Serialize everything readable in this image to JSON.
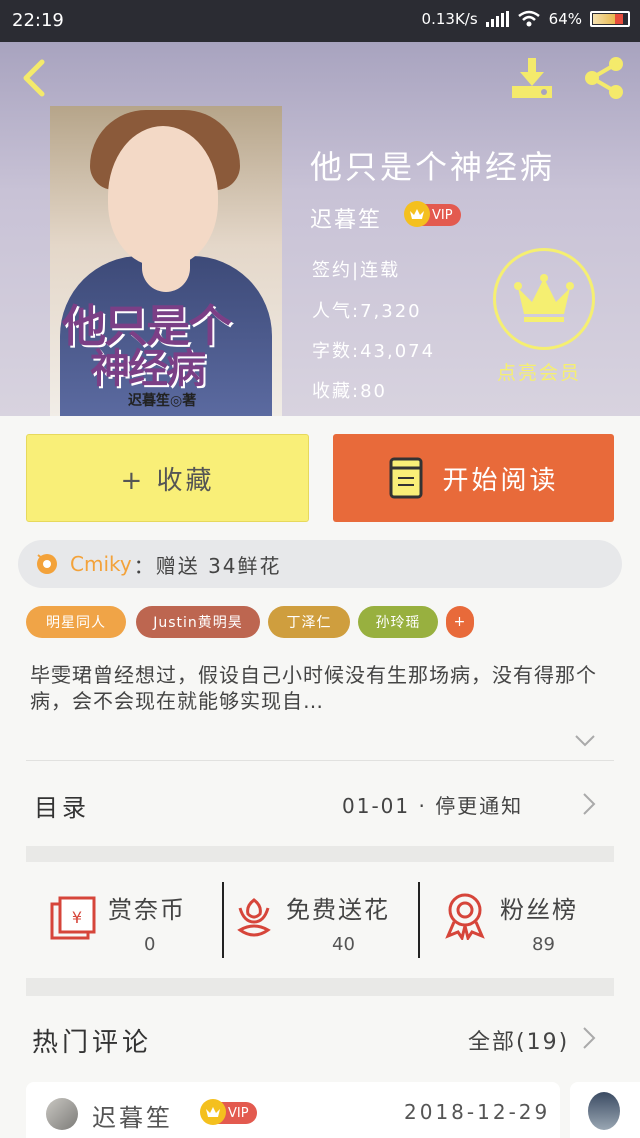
{
  "status_bar": {
    "time": "22:19",
    "speed": "0.13K/s",
    "battery": "64%"
  },
  "book": {
    "title": "他只是个神经病",
    "author": "迟暮笙",
    "author_badge": "VIP",
    "status": "签约|连载",
    "popularity": "人气:7,320",
    "word_count": "字数:43,074",
    "favorites": "收藏:80",
    "cover_title_line1": "他只是个",
    "cover_title_line2": "神经病",
    "cover_author": "迟暮笙◎著"
  },
  "member": {
    "label": "点亮会员"
  },
  "actions": {
    "collect_label": "+ 收藏",
    "read_label": "开始阅读"
  },
  "gift": {
    "user": "Cmiky",
    "text": "：赠送 34鲜花"
  },
  "tags": [
    "明星同人",
    "Justin黄明昊",
    "丁泽仁",
    "孙玲瑶",
    "+"
  ],
  "description": "毕雯珺曾经想过，假设自己小时候没有生那场病，没有得那个病，会不会现在就能够实现自…",
  "catalog": {
    "label": "目录",
    "latest": "01-01 · 停更通知"
  },
  "stats": [
    {
      "label": "赏奈币",
      "value": "0"
    },
    {
      "label": "免费送花",
      "value": "40"
    },
    {
      "label": "粉丝榜",
      "value": "89"
    }
  ],
  "comments": {
    "header": "热门评论",
    "all_label": "全部(19)",
    "first": {
      "author": "迟暮笙",
      "badge": "VIP",
      "date": "2018-12-29"
    }
  },
  "colors": {
    "collect_bg": "#f9ef78",
    "read_bg": "#e86a3a",
    "vip_bg": "#e35a4f",
    "member_accent": "#f5ef71",
    "gift_name": "#f3a23a"
  }
}
